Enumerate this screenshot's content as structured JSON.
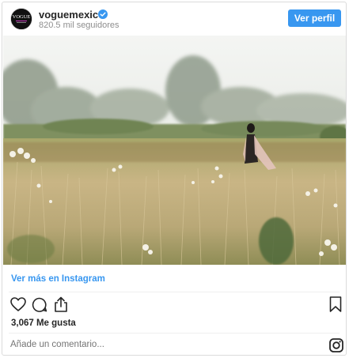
{
  "header": {
    "username": "voguemexico",
    "followers": "820.5 mil seguidores",
    "view_profile_label": "Ver perfil",
    "avatar_text": "VOGUE"
  },
  "post": {
    "view_more_label": "Ver más en Instagram",
    "likes": "3,067 Me gusta",
    "comment_placeholder": "Añade un comentario..."
  },
  "icons": [
    "heart-icon",
    "comment-icon",
    "share-icon",
    "bookmark-icon",
    "instagram-icon",
    "verified-icon"
  ],
  "colors": {
    "accent": "#3897f0",
    "text": "#262626",
    "muted": "#8e8e8e",
    "border": "#dbdbdb"
  }
}
